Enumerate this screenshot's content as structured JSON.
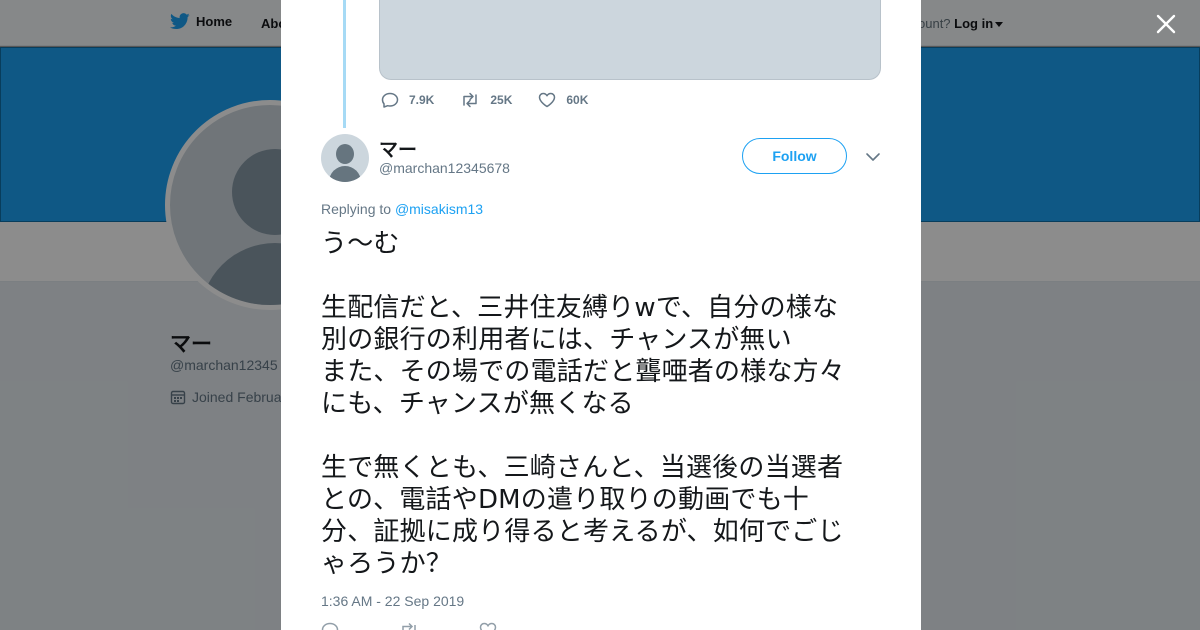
{
  "nav": {
    "home_label": "Home",
    "about_label": "Abo",
    "account_prompt": "ccount?",
    "login_label": "Log in"
  },
  "background_profile": {
    "name": "マー",
    "handle": "@marchan12345",
    "joined": "Joined Februa"
  },
  "thread": {
    "reply_count": "7.9K",
    "retweet_count": "25K",
    "like_count": "60K"
  },
  "tweet": {
    "author_name": "マー",
    "author_handle": "@marchan12345678",
    "follow_label": "Follow",
    "replying_prefix": "Replying to ",
    "replying_handle": "@misakism13",
    "text": "う～む\n\n生配信だと、三井住友縛りwで、自分の様な\n別の銀行の利用者には、チャンスが無い\nまた、その場での電話だと聾唖者の様な方々\nにも、チャンスが無くなる\n\n生で無くとも、三崎さんと、当選後の当選者\nとの、電話やDMの遣り取りの動画でも十\n分、証拠に成り得ると考えるが、如何でごじ\nゃろうか？",
    "timestamp": "1:36 AM - 22 Sep 2019"
  },
  "colors": {
    "accent": "#1da1f2",
    "text": "#14171a",
    "muted": "#657786",
    "thread_line": "#a6daf5"
  },
  "icons": [
    "twitter-bird-icon",
    "close-icon",
    "reply-icon",
    "retweet-icon",
    "like-icon",
    "chevron-down-icon",
    "calendar-icon"
  ]
}
